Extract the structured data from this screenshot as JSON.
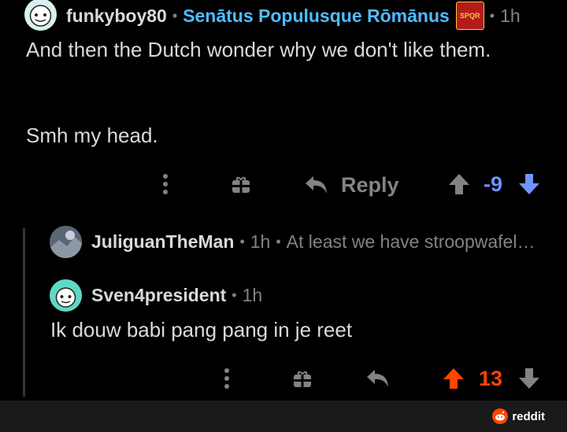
{
  "comment1": {
    "username": "funkyboy80",
    "flair": "Senātus Populusque Rōmānus",
    "flair_badge": "SPQR",
    "time": "1h",
    "body_line1": "And then the Dutch wonder why we don't like them.",
    "body_line2": "Smh my head.",
    "reply_label": "Reply",
    "score": "-9"
  },
  "collapsed_reply": {
    "username": "JuliguanTheMan",
    "time": "1h",
    "preview": "At least we have stroopwafel…"
  },
  "comment2": {
    "username": "Sven4president",
    "time": "1h",
    "body": "Ik douw babi pang pang in je reet",
    "score": "13"
  },
  "footer": {
    "brand": "reddit"
  },
  "colors": {
    "upvote": "#ff4500",
    "downvote": "#7193ff",
    "flair": "#4fbcff",
    "muted": "#818384"
  }
}
